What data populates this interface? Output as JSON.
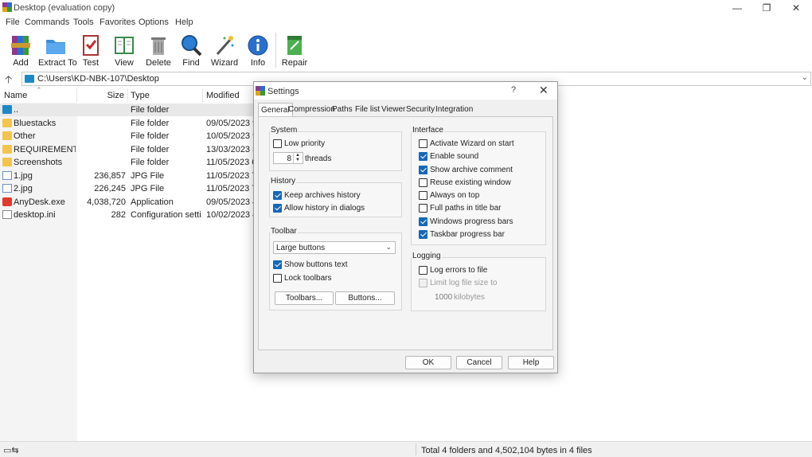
{
  "window": {
    "title": "Desktop (evaluation copy)",
    "controls": [
      "—",
      "❐",
      "✕"
    ]
  },
  "menu": [
    "File",
    "Commands",
    "Tools",
    "Favorites",
    "Options",
    "Help"
  ],
  "toolbar": [
    {
      "label": "Add",
      "icon": "add-archive-icon"
    },
    {
      "label": "Extract To",
      "icon": "extract-folder-icon"
    },
    {
      "label": "Test",
      "icon": "test-icon"
    },
    {
      "label": "View",
      "icon": "view-book-icon"
    },
    {
      "label": "Delete",
      "icon": "trash-icon"
    },
    {
      "label": "Find",
      "icon": "magnifier-icon"
    },
    {
      "label": "Wizard",
      "icon": "wand-icon"
    },
    {
      "label": "Info",
      "icon": "info-icon"
    },
    {
      "label": "Repair",
      "icon": "repair-icon"
    }
  ],
  "address": {
    "path": "C:\\Users\\KD-NBK-107\\Desktop",
    "up": "🡡",
    "dropdown": "⌄"
  },
  "columns": {
    "name": "Name",
    "size": "Size",
    "type": "Type",
    "modified": "Modified",
    "sort_arrow": "⌃"
  },
  "files": [
    {
      "name": "..",
      "size": "",
      "type": "File folder",
      "modified": "",
      "icon": "up-folder"
    },
    {
      "name": "Bluestacks",
      "size": "",
      "type": "File folder",
      "modified": "09/05/2023 9",
      "icon": "folder"
    },
    {
      "name": "Other",
      "size": "",
      "type": "File folder",
      "modified": "10/05/2023 9",
      "icon": "folder"
    },
    {
      "name": "REQUIREMENTS",
      "size": "",
      "type": "File folder",
      "modified": "13/03/2023 3",
      "icon": "folder"
    },
    {
      "name": "Screenshots",
      "size": "",
      "type": "File folder",
      "modified": "11/05/2023 6",
      "icon": "folder"
    },
    {
      "name": "1.jpg",
      "size": "236,857",
      "type": "JPG File",
      "modified": "11/05/2023 7",
      "icon": "image"
    },
    {
      "name": "2.jpg",
      "size": "226,245",
      "type": "JPG File",
      "modified": "11/05/2023 7",
      "icon": "image"
    },
    {
      "name": "AnyDesk.exe",
      "size": "4,038,720",
      "type": "Application",
      "modified": "09/05/2023 4",
      "icon": "exe"
    },
    {
      "name": "desktop.ini",
      "size": "282",
      "type": "Configuration setti...",
      "modified": "10/02/2023 4",
      "icon": "ini"
    }
  ],
  "status": {
    "text": "Total 4 folders and 4,502,104 bytes in 4 files",
    "icon": "▭⇆"
  },
  "dialog": {
    "title": "Settings",
    "help": "?",
    "close": "✕",
    "tabs": [
      "General",
      "Compression",
      "Paths",
      "File list",
      "Viewer",
      "Security",
      "Integration"
    ],
    "active_tab": "General",
    "system": {
      "label": "System",
      "low_priority": {
        "label": "Low priority",
        "checked": false
      },
      "threads": {
        "value": "8",
        "label": "threads"
      }
    },
    "history": {
      "label": "History",
      "keep": {
        "label": "Keep archives history",
        "checked": true
      },
      "dialogs": {
        "label": "Allow history in dialogs",
        "checked": true
      }
    },
    "toolbar_group": {
      "label": "Toolbar",
      "size_select": "Large buttons",
      "show_text": {
        "label": "Show buttons text",
        "checked": true
      },
      "lock": {
        "label": "Lock toolbars",
        "checked": false
      },
      "toolbars_btn": "Toolbars...",
      "buttons_btn": "Buttons..."
    },
    "interface": {
      "label": "Interface",
      "items": [
        {
          "label": "Activate Wizard on start",
          "checked": false
        },
        {
          "label": "Enable sound",
          "checked": true
        },
        {
          "label": "Show archive comment",
          "checked": true
        },
        {
          "label": "Reuse existing window",
          "checked": false
        },
        {
          "label": "Always on top",
          "checked": false
        },
        {
          "label": "Full paths in title bar",
          "checked": false
        },
        {
          "label": "Windows progress bars",
          "checked": true
        },
        {
          "label": "Taskbar progress bar",
          "checked": true
        }
      ]
    },
    "logging": {
      "label": "Logging",
      "log_errors": {
        "label": "Log errors to file",
        "checked": false
      },
      "limit": {
        "label": "Limit log file size to",
        "checked": false,
        "disabled": true
      },
      "limit_value": "1000",
      "limit_unit": "kilobytes"
    },
    "buttons": {
      "ok": "OK",
      "cancel": "Cancel",
      "help": "Help"
    }
  },
  "colors": {
    "accent": "#1468b8",
    "folder": "#f4c44b",
    "selected_row": "#e8e8e8"
  }
}
